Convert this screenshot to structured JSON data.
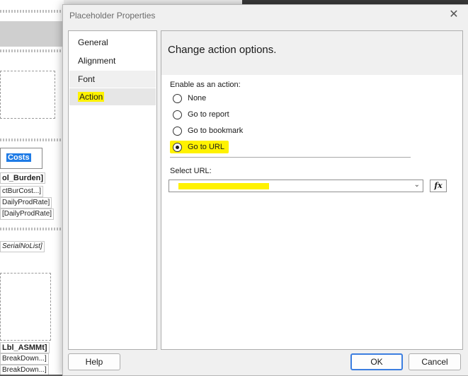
{
  "background": {
    "fields": [
      "Costs",
      "ol_Burden]",
      "ctBurCost...]",
      "DailyProdRate]",
      "[DailyProdRate]",
      "SerialNoList]",
      "Lbl_ASMMt]",
      "BreakDown...]",
      "BreakDown...]"
    ]
  },
  "dialog": {
    "title": "Placeholder Properties",
    "close_glyph": "✕",
    "nav": [
      {
        "label": "General"
      },
      {
        "label": "Alignment"
      },
      {
        "label": "Font"
      },
      {
        "label": "Action"
      }
    ],
    "content": {
      "heading": "Change action options.",
      "enable_label": "Enable as an action:",
      "options": [
        {
          "label": "None",
          "checked": false
        },
        {
          "label": "Go to report",
          "checked": false
        },
        {
          "label": "Go to bookmark",
          "checked": false
        },
        {
          "label": "Go to URL",
          "checked": true
        }
      ],
      "url_label": "Select URL:",
      "url_value": "",
      "fx_label": "fx"
    },
    "buttons": {
      "help": "Help",
      "ok": "OK",
      "cancel": "Cancel"
    }
  },
  "colors": {
    "highlight": "#fff200",
    "primary_border": "#3c7ee0"
  }
}
